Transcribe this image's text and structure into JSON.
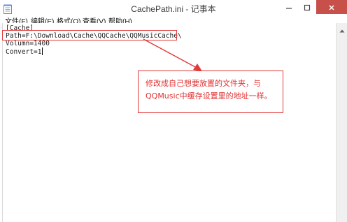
{
  "window": {
    "title": "CachePath.ini - 记事本",
    "app_icon": "notepad-icon",
    "controls": {
      "minimize_icon": "minimize-icon",
      "maximize_icon": "maximize-icon",
      "close_icon": "close-icon",
      "close_color": "#c7504a"
    }
  },
  "menubar": {
    "items": [
      {
        "label": "文件(F)"
      },
      {
        "label": "编辑(E)"
      },
      {
        "label": "格式(O)"
      },
      {
        "label": "查看(V)"
      },
      {
        "label": "帮助(H)"
      }
    ]
  },
  "editor": {
    "lines": [
      "[Cache]",
      "Path=F:\\Download\\Cache\\QQCache\\QQMusicCache\\",
      "Volumn=1400",
      "Convert=1"
    ]
  },
  "annotation": {
    "line1": "修改成自己想要放置的文件夹，与",
    "line2": "QQMusic中缓存设置里的地址一样。",
    "color": "#e23030"
  }
}
